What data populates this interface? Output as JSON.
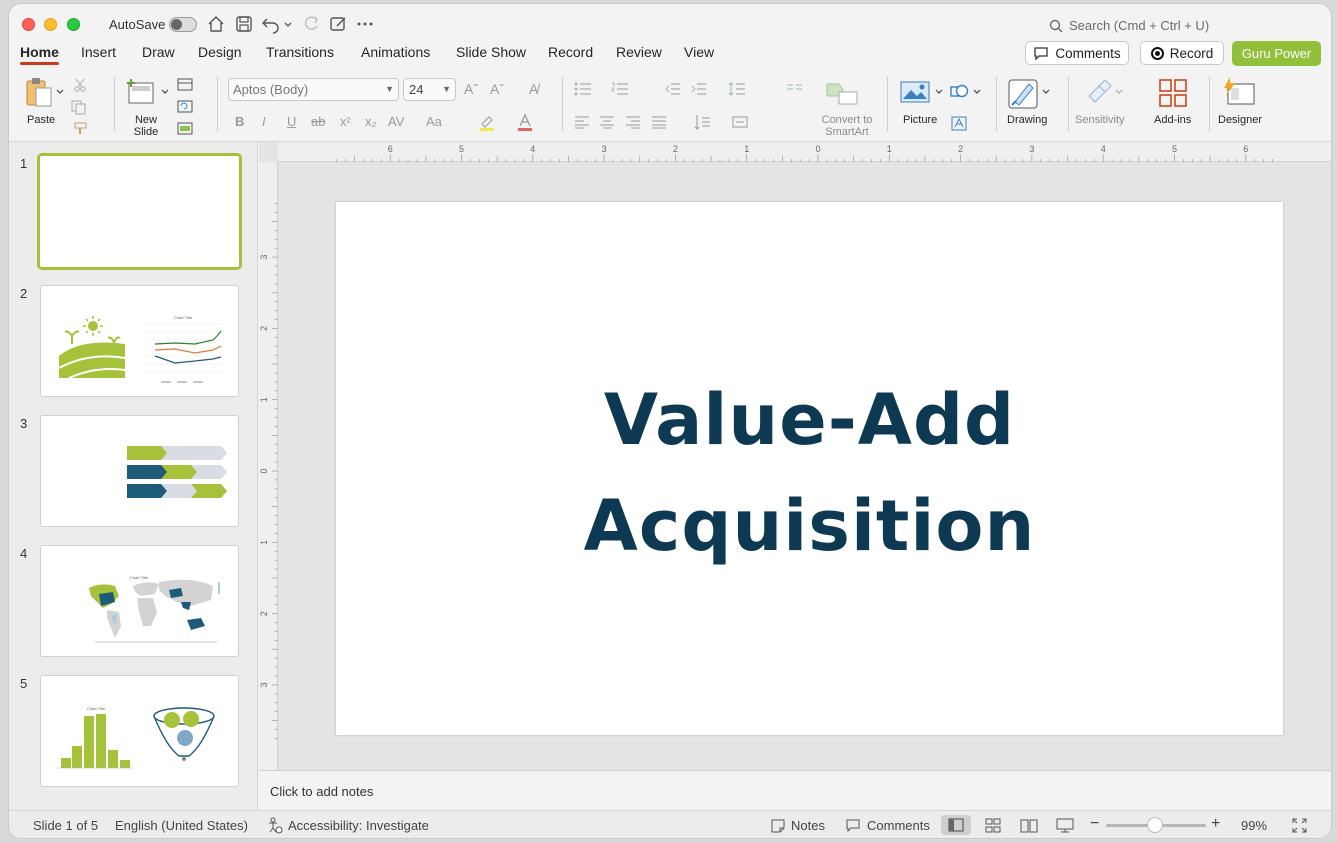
{
  "titlebar": {
    "autosave_label": "AutoSave",
    "search_placeholder": "Search (Cmd + Ctrl + U)"
  },
  "tabs": [
    "Home",
    "Insert",
    "Draw",
    "Design",
    "Transitions",
    "Animations",
    "Slide Show",
    "Record",
    "Review",
    "View"
  ],
  "active_tab": "Home",
  "header_buttons": {
    "comments": "Comments",
    "record": "Record",
    "guru": "Guru Power"
  },
  "ribbon": {
    "paste": "Paste",
    "new_slide": "New Slide",
    "font_name": "Aptos (Body)",
    "font_size": "24",
    "convert_smartart": "Convert to SmartArt",
    "picture": "Picture",
    "drawing": "Drawing",
    "sensitivity": "Sensitivity",
    "addins": "Add-ins",
    "designer": "Designer"
  },
  "slides": [
    {
      "number": "1",
      "selected": true
    },
    {
      "number": "2"
    },
    {
      "number": "3"
    },
    {
      "number": "4"
    },
    {
      "number": "5"
    }
  ],
  "thumb_text": {
    "chart_title": "Chart Title"
  },
  "ruler_h_labels": [
    "6",
    "5",
    "4",
    "3",
    "2",
    "1",
    "0",
    "1",
    "2",
    "3",
    "4",
    "5",
    "6"
  ],
  "ruler_v_labels": [
    "3",
    "2",
    "1",
    "0",
    "1",
    "2",
    "3"
  ],
  "slide": {
    "title_line1": "Value-Add",
    "title_line2": "Acquisition"
  },
  "notes_placeholder": "Click to add notes",
  "status": {
    "slide_of": "Slide 1 of 5",
    "language": "English (United States)",
    "accessibility": "Accessibility: Investigate",
    "notes": "Notes",
    "comments": "Comments",
    "zoom": "99%"
  },
  "colors": {
    "accent_green": "#92c03b",
    "title_navy": "#0d3a52",
    "tab_underline": "#c43e1c"
  }
}
